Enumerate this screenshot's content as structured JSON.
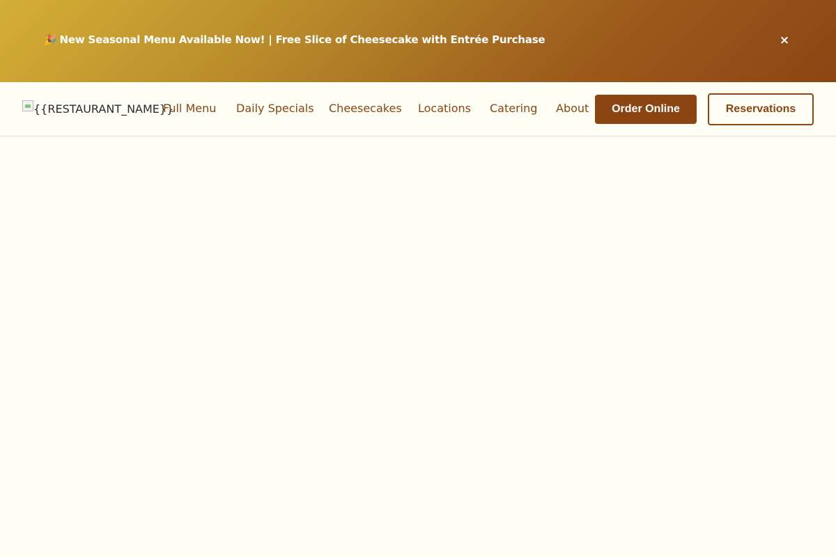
{
  "promo_banner": {
    "emoji": "🎉",
    "text": "New Seasonal Menu Available Now! | Free Slice of Cheesecake with Entrée Purchase",
    "close_label": "×",
    "colors": {
      "gradient_start": "#d4af37",
      "gradient_end": "#8b4513",
      "text": "#ffffff"
    }
  },
  "navbar": {
    "logo_alt": "{{RESTAURANT_NAME}}",
    "links": [
      {
        "label": "Full Menu"
      },
      {
        "label": "Daily Specials"
      },
      {
        "label": "Cheesecakes"
      },
      {
        "label": "Locations"
      },
      {
        "label": "Catering"
      },
      {
        "label": "About"
      }
    ],
    "order_button": "Order Online",
    "reservations_button": "Reservations",
    "colors": {
      "brand": "#8b4513",
      "background": "#fffef5"
    }
  }
}
